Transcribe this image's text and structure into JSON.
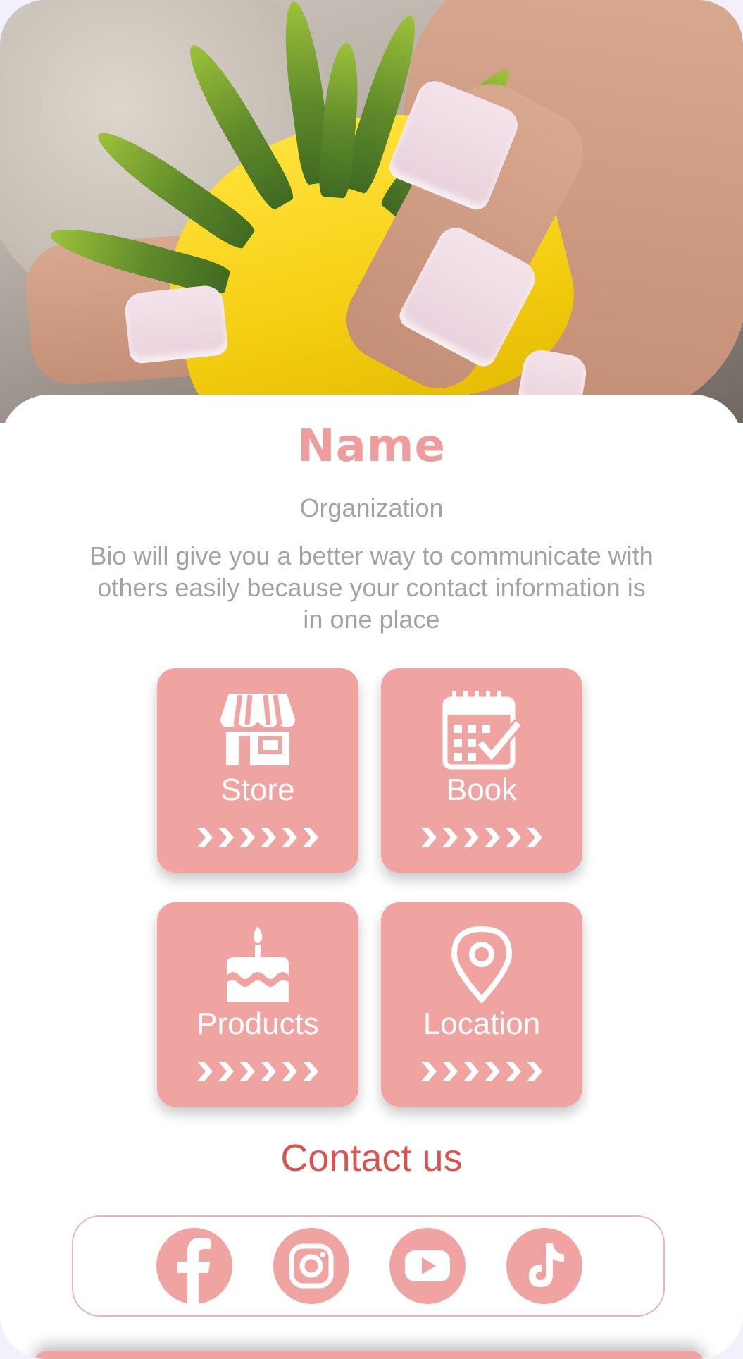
{
  "hero": {
    "image_description_icon": "hands-holding-succulent-photo"
  },
  "profile": {
    "name": "Name",
    "organization": "Organization",
    "bio": "Bio will give you a better way to communicate with others easily because your contact information is in one place"
  },
  "tiles": [
    {
      "label": "Store",
      "icon": "store-icon",
      "arrows": "❯❯❯❯❯❯"
    },
    {
      "label": "Book",
      "icon": "calendar-check-icon",
      "arrows": "❯❯❯❯❯❯"
    },
    {
      "label": "Products",
      "icon": "cake-icon",
      "arrows": "❯❯❯❯❯❯"
    },
    {
      "label": "Location",
      "icon": "location-pin-icon",
      "arrows": "❯❯❯❯❯❯"
    }
  ],
  "contact": {
    "title": "Contact us",
    "socials": [
      {
        "icon": "facebook-icon"
      },
      {
        "icon": "instagram-icon"
      },
      {
        "icon": "youtube-icon"
      },
      {
        "icon": "tiktok-icon"
      }
    ]
  },
  "colors": {
    "accent": "#f0a4a2",
    "name": "#ef9c9c",
    "contact_title": "#d9534f",
    "muted_text": "#a3a3a3",
    "border": "#e8b4b4"
  }
}
